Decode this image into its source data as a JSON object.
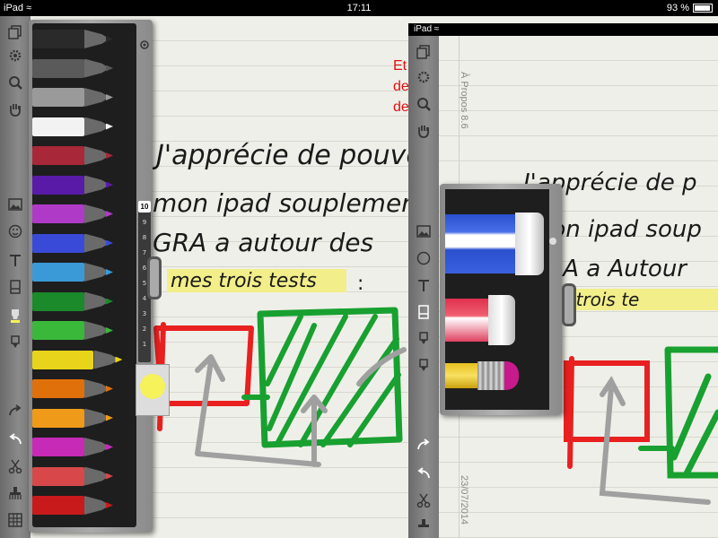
{
  "status_bar": {
    "device": "iPad",
    "time": "17:11",
    "battery": "93 %",
    "battery_level": 0.93
  },
  "toolbar": {
    "icons": [
      "pages-icon",
      "settings-gear-icon",
      "zoom-icon",
      "hand-icon",
      "image-icon",
      "emoji-icon",
      "text-icon",
      "eraser-icon",
      "highlighter-icon",
      "marker-icon",
      "redo-icon",
      "undo-icon",
      "scissors-icon",
      "clear-icon",
      "grid-icon"
    ]
  },
  "palette": {
    "markers": [
      {
        "name": "black",
        "color": "#2a2a2a"
      },
      {
        "name": "dark-gray",
        "color": "#5a5a5a"
      },
      {
        "name": "gray",
        "color": "#9a9a9a"
      },
      {
        "name": "white",
        "color": "#f2f2f2"
      },
      {
        "name": "crimson",
        "color": "#a8283a"
      },
      {
        "name": "purple",
        "color": "#5a1aa8"
      },
      {
        "name": "violet",
        "color": "#b03ac8"
      },
      {
        "name": "blue",
        "color": "#3a4ad8"
      },
      {
        "name": "light-blue",
        "color": "#3a9ad8"
      },
      {
        "name": "dark-green",
        "color": "#1a8a2a"
      },
      {
        "name": "green",
        "color": "#3ab83a"
      },
      {
        "name": "yellow",
        "color": "#e8d41a",
        "selected": true
      },
      {
        "name": "orange",
        "color": "#e0700a"
      },
      {
        "name": "light-orange",
        "color": "#f09a1a"
      },
      {
        "name": "magenta",
        "color": "#c82ab8"
      },
      {
        "name": "salmon",
        "color": "#d8484a"
      },
      {
        "name": "red",
        "color": "#c81a1a"
      }
    ],
    "ruler_badge": "10",
    "ruler_numbers": [
      "9",
      "8",
      "7",
      "6",
      "5",
      "4",
      "3",
      "2",
      "1"
    ],
    "selected_color": "#f5f25a"
  },
  "note": {
    "handwriting_line1": "J'apprécie de pouvoir é",
    "handwriting_line2": "mon ipad souplement",
    "handwriting_line3": "GRA a autour des",
    "highlighted": "mes trois tests",
    "colon": ":",
    "red_text": [
      "Et",
      "de",
      "de"
    ]
  },
  "screen2": {
    "device": "iPad",
    "sidebar_title": "À Propos 8.6",
    "sidebar_date": "23/07/2014",
    "handwriting_line1": "J'apprécie de p",
    "handwriting_line2": "mon ipad soup",
    "handwriting_line3": "GRA a Autour",
    "highlighted": "mes trois te"
  },
  "colors": {
    "highlight": "#f2ee8a",
    "red_stroke": "#e82020",
    "green_stroke": "#18a030",
    "gray_stroke": "#a0a0a0"
  }
}
